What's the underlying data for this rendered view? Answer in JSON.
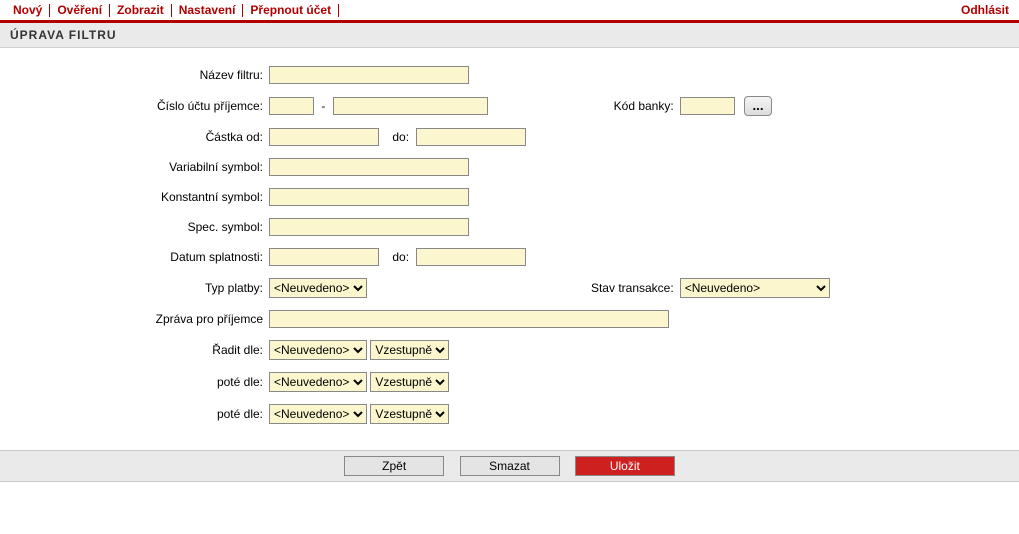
{
  "menu": {
    "items": [
      "Nový",
      "Ověření",
      "Zobrazit",
      "Nastavení",
      "Přepnout účet"
    ],
    "logout": "Odhlásit"
  },
  "section_title": "ÚPRAVA FILTRU",
  "labels": {
    "filter_name": "Název filtru:",
    "recipient_account": "Číslo účtu příjemce:",
    "bank_code": "Kód banky:",
    "amount_from": "Částka od:",
    "amount_to": "do:",
    "variable_symbol": "Variabilní symbol:",
    "constant_symbol": "Konstantní symbol:",
    "spec_symbol": "Spec. symbol:",
    "due_date": "Datum splatnosti:",
    "due_date_to": "do:",
    "payment_type": "Typ platby:",
    "tx_state": "Stav transakce:",
    "message": "Zpráva pro příjemce",
    "sort_by": "Řadit dle:",
    "then_by": "poté dle:",
    "then_by2": "poté dle:"
  },
  "values": {
    "filter_name": "",
    "account_prefix": "",
    "account_number": "",
    "bank_code": "",
    "amount_from": "",
    "amount_to": "",
    "variable_symbol": "",
    "constant_symbol": "",
    "spec_symbol": "",
    "due_from": "",
    "due_to": "",
    "message": ""
  },
  "selects": {
    "unspecified": "<Neuvedeno>",
    "ascending": "Vzestupně"
  },
  "buttons": {
    "ellipsis": "...",
    "back": "Zpět",
    "delete": "Smazat",
    "save": "Uložit"
  }
}
